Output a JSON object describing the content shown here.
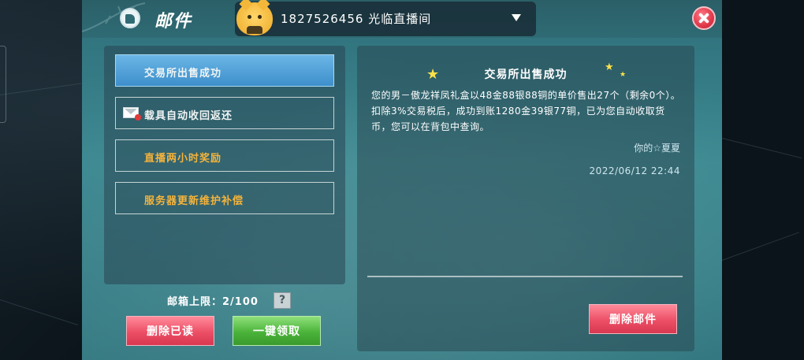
{
  "window": {
    "title": "邮件"
  },
  "account": {
    "name": "1827526456 光临直播间"
  },
  "mail_list": {
    "items": [
      {
        "label": "交易所出售成功",
        "state": "selected"
      },
      {
        "label": "载具自动收回返还",
        "state": "read",
        "icon": "envelope-icon"
      },
      {
        "label": "直播两小时奖励",
        "state": "unread"
      },
      {
        "label": "服务器更新维护补偿",
        "state": "unread"
      }
    ]
  },
  "capacity": {
    "label": "邮箱上限：2/100",
    "help": "?"
  },
  "actions": {
    "delete_read": "删除已读",
    "claim_all": "一键领取",
    "delete_mail": "删除邮件"
  },
  "mail": {
    "title": "交易所出售成功",
    "body": "您的男－傲龙祥凤礼盒以48金88银88铜的单价售出27个（剩余0个）。扣除3%交易税后，成功到账1280金39银77铜，已为您自动收取货币，您可以在背包中查询。",
    "sender": "你的☆夏夏",
    "date": "2022/06/12 22:44"
  },
  "colors": {
    "selected_item": "#4a9bd4",
    "unread_text": "#f5b33b",
    "red_button": "#e8506a",
    "green_button": "#4ab33a",
    "close_button": "#e0384a"
  }
}
